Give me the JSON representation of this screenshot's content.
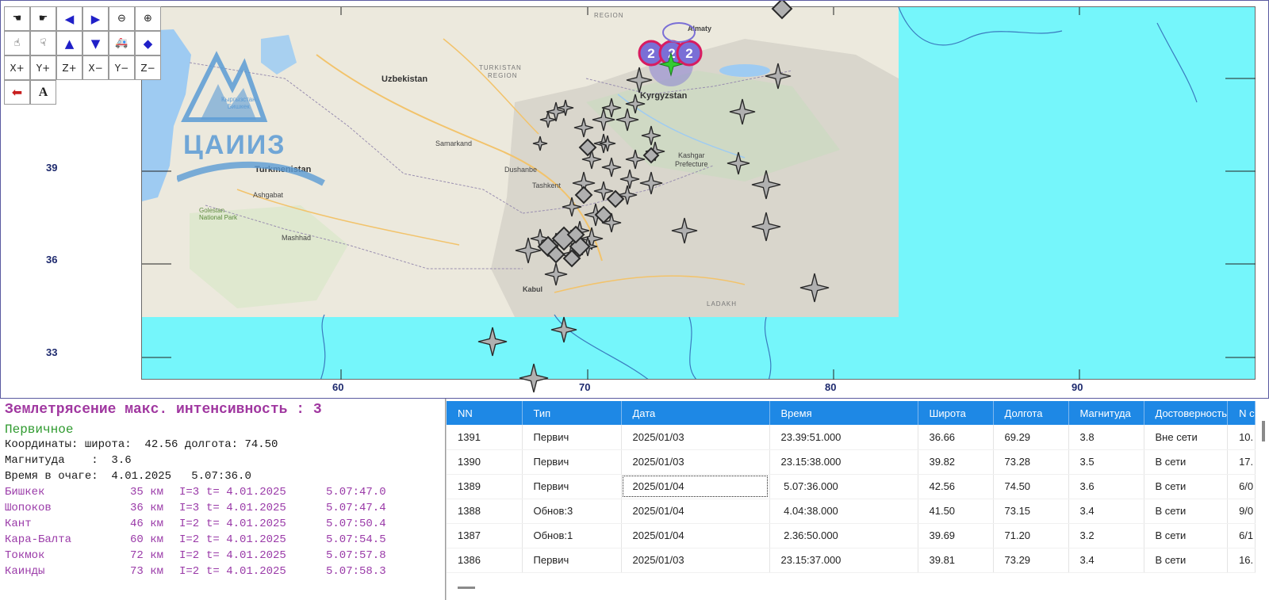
{
  "toolbar": {
    "row3": [
      "X+",
      "Y+",
      "Z+",
      "X−",
      "Y−",
      "Z−"
    ],
    "text_tool": "A"
  },
  "logo": {
    "text": "ЦАИИЗ",
    "sub_line1": "Кыргызстан",
    "sub_line2": "Бишкек"
  },
  "map": {
    "axis_y": [
      "39",
      "36",
      "33"
    ],
    "axis_x": [
      "60",
      "70",
      "80",
      "90"
    ],
    "labels": {
      "uzbekistan": "Uzbekistan",
      "turkmenistan": "Turkmenistan",
      "kyrgyzstan": "Kyrgyzstan",
      "turkistan": "TURKISTAN",
      "region_turk": "REGION",
      "almaty": "Almaty",
      "ashgabat": "Ashgabat",
      "mashhad": "Mashhad",
      "samarkand": "Samarkand",
      "dushanbe": "Dushanbe",
      "tashkent": "Tashkent",
      "kabul": "Kabul",
      "kashgar": "Kashgar",
      "prefecture": "Prefecture",
      "ladakh": "LADAKH",
      "region_top": "REGION",
      "golestan": "Golestan National Park"
    },
    "colors": {
      "sea": "#75f6fb",
      "land": "#ece9dd",
      "marker_fill": "#b0b0b0",
      "marker_stroke": "#2a2a2a",
      "epicenter": "#33cc33",
      "intensity_ring": "#d81b60",
      "intensity_fill": "#7a6fd6"
    },
    "intensity_badges": [
      "2",
      "2",
      "2"
    ]
  },
  "info": {
    "title": "Землетрясение макс. интенсивность : 3",
    "kind": "Первичное",
    "coords": "Координаты: широта:  42.56 долгота: 74.50",
    "magnitude": "Магнитуда    :  3.6",
    "focus_time": "Время в очаге:  4.01.2025   5.07:36.0",
    "cities": [
      {
        "name": "Бишкек",
        "dist": "35 км",
        "intensity": "I=3",
        "t": "t= 4.01.2025",
        "time": "5.07:47.0"
      },
      {
        "name": "Шопоков",
        "dist": "36 км",
        "intensity": "I=3",
        "t": "t= 4.01.2025",
        "time": "5.07:47.4"
      },
      {
        "name": "Кант",
        "dist": "46 км",
        "intensity": "I=2",
        "t": "t= 4.01.2025",
        "time": "5.07:50.4"
      },
      {
        "name": "Кара-Балта",
        "dist": "60 км",
        "intensity": "I=2",
        "t": "t= 4.01.2025",
        "time": "5.07:54.5"
      },
      {
        "name": "Токмок",
        "dist": "72 км",
        "intensity": "I=2",
        "t": "t= 4.01.2025",
        "time": "5.07:57.8"
      },
      {
        "name": "Каинды",
        "dist": "73 км",
        "intensity": "I=2",
        "t": "t= 4.01.2025",
        "time": "5.07:58.3"
      }
    ]
  },
  "table": {
    "columns": [
      "NN",
      "Тип",
      "Дата",
      "Время",
      "Широта",
      "Долгота",
      "Магнитуда",
      "Достоверность",
      "N с"
    ],
    "rows": [
      [
        "1391",
        "Первич",
        "2025/01/03",
        "23.39:51.000",
        "36.66",
        "69.29",
        "3.8",
        "Вне сети",
        "10."
      ],
      [
        "1390",
        "Первич",
        "2025/01/03",
        "23.15:38.000",
        "39.82",
        "73.28",
        "3.5",
        "В сети",
        "17."
      ],
      [
        "1389",
        "Первич",
        "2025/01/04",
        " 5.07:36.000",
        "42.56",
        "74.50",
        "3.6",
        "В сети",
        "6/0"
      ],
      [
        "1388",
        "Обнов:3",
        "2025/01/04",
        " 4.04:38.000",
        "41.50",
        "73.15",
        "3.4",
        "В сети",
        "9/0"
      ],
      [
        "1387",
        "Обнов:1",
        "2025/01/04",
        " 2.36:50.000",
        "39.69",
        "71.20",
        "3.2",
        "В сети",
        "6/1"
      ],
      [
        "1386",
        "Первич",
        "2025/01/03",
        "23.15:37.000",
        "39.81",
        "73.29",
        "3.4",
        "В сети",
        "16."
      ]
    ],
    "selected_row": 2,
    "selected_col": 2
  }
}
